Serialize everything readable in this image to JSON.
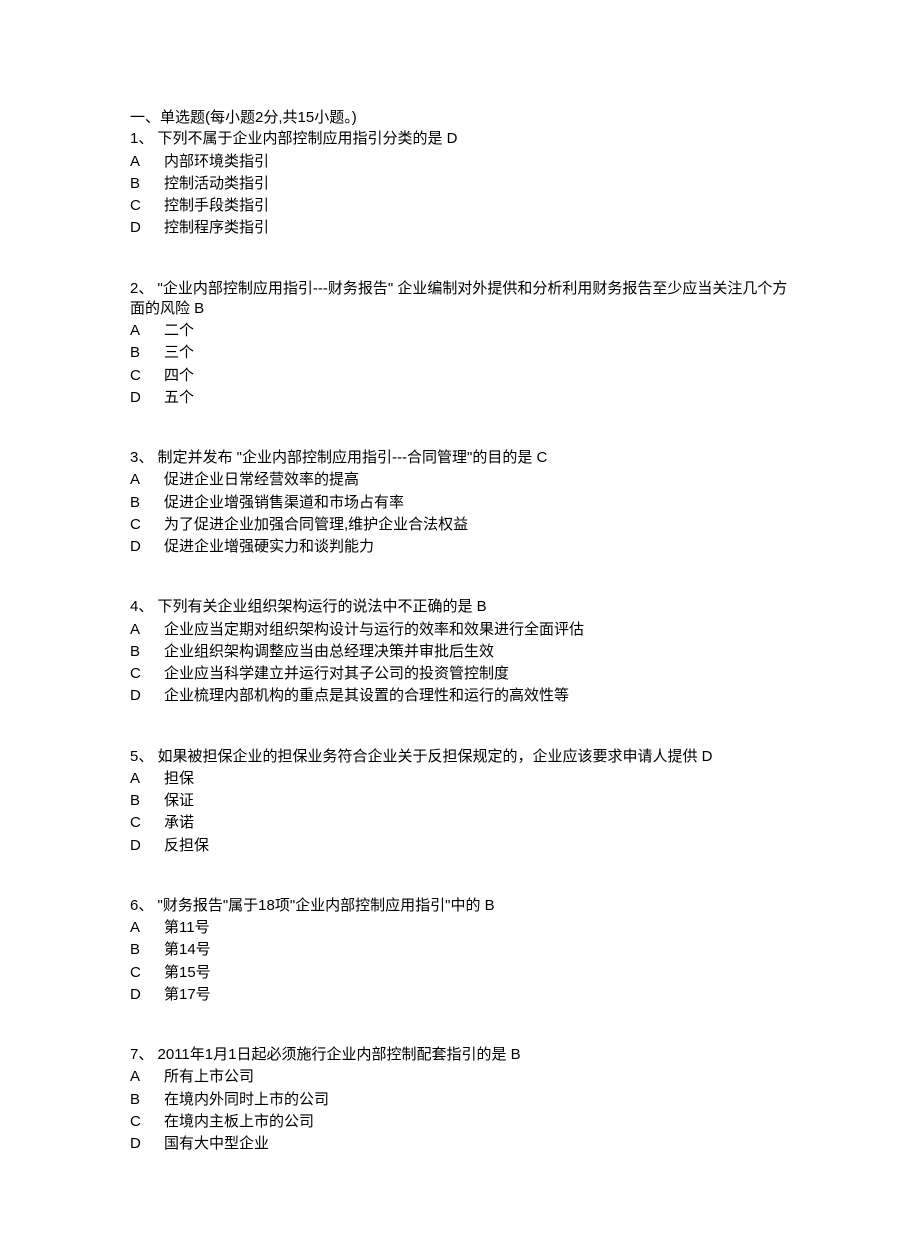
{
  "heading": "一、单选题(每小题2分,共15小题。)",
  "questions": [
    {
      "stem": "1、 下列不属于企业内部控制应用指引分类的是  D",
      "options": [
        {
          "letter": "A",
          "text": "内部环境类指引"
        },
        {
          "letter": "B",
          "text": "控制活动类指引"
        },
        {
          "letter": "C",
          "text": "控制手段类指引"
        },
        {
          "letter": "D",
          "text": "控制程序类指引"
        }
      ]
    },
    {
      "stem": "2、 \"企业内部控制应用指引---财务报告\"  企业编制对外提供和分析利用财务报告至少应当关注几个方面的风险  B",
      "options": [
        {
          "letter": "A",
          "text": "二个"
        },
        {
          "letter": "B",
          "text": "三个"
        },
        {
          "letter": "C",
          "text": "四个"
        },
        {
          "letter": "D",
          "text": "五个"
        }
      ]
    },
    {
      "stem": "3、 制定并发布  \"企业内部控制应用指引---合同管理\"的目的是  C",
      "options": [
        {
          "letter": "A",
          "text": "促进企业日常经营效率的提高"
        },
        {
          "letter": "B",
          "text": "促进企业增强销售渠道和市场占有率"
        },
        {
          "letter": "C",
          "text": "为了促进企业加强合同管理,维护企业合法权益"
        },
        {
          "letter": "D",
          "text": "促进企业增强硬实力和谈判能力"
        }
      ]
    },
    {
      "stem": "4、 下列有关企业组织架构运行的说法中不正确的是  B",
      "options": [
        {
          "letter": "A",
          "text": " 企业应当定期对组织架构设计与运行的效率和效果进行全面评估"
        },
        {
          "letter": "B",
          "text": "企业组织架构调整应当由总经理决策并审批后生效"
        },
        {
          "letter": "C",
          "text": "企业应当科学建立并运行对其子公司的投资管控制度"
        },
        {
          "letter": "D",
          "text": "企业梳理内部机构的重点是其设置的合理性和运行的高效性等"
        }
      ]
    },
    {
      "stem": "5、 如果被担保企业的担保业务符合企业关于反担保规定的，企业应该要求申请人提供  D",
      "options": [
        {
          "letter": "A",
          "text": "担保"
        },
        {
          "letter": "B",
          "text": "保证"
        },
        {
          "letter": "C",
          "text": "承诺"
        },
        {
          "letter": "D",
          "text": "反担保"
        }
      ]
    },
    {
      "stem": "6、 \"财务报告\"属于18项\"企业内部控制应用指引\"中的  B",
      "options": [
        {
          "letter": "A",
          "text": "第11号"
        },
        {
          "letter": "B",
          "text": "第14号"
        },
        {
          "letter": "C",
          "text": "第15号"
        },
        {
          "letter": "D",
          "text": "第17号"
        }
      ]
    },
    {
      "stem": "7、  2011年1月1日起必须施行企业内部控制配套指引的是  B",
      "options": [
        {
          "letter": "A",
          "text": "所有上市公司"
        },
        {
          "letter": "B",
          "text": "在境内外同时上市的公司"
        },
        {
          "letter": "C",
          "text": "在境内主板上市的公司"
        },
        {
          "letter": "D",
          "text": "国有大中型企业"
        }
      ]
    }
  ]
}
